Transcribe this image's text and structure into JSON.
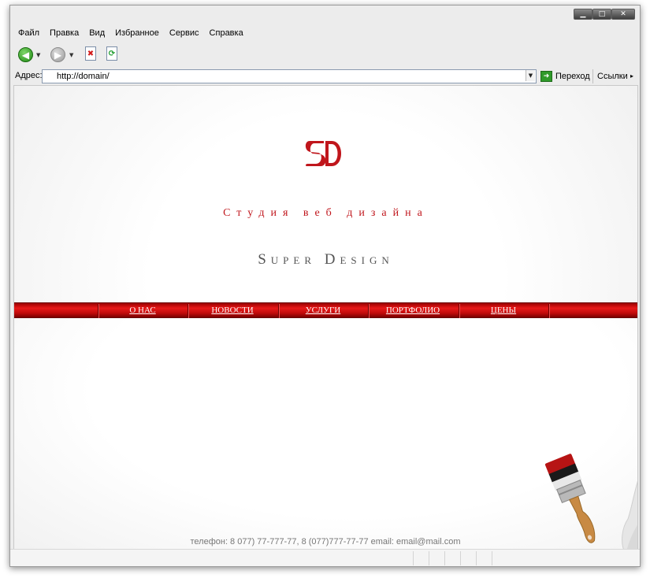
{
  "window": {
    "controls": {
      "minimize": "▁",
      "maximize": "□",
      "close": "✕"
    }
  },
  "menu": {
    "items": [
      "Файл",
      "Правка",
      "Вид",
      "Избранное",
      "Сервис",
      "Справка"
    ]
  },
  "toolbar": {
    "icons": [
      "back-icon",
      "forward-icon",
      "stop-icon",
      "refresh-icon"
    ]
  },
  "address": {
    "label": "Адрес:",
    "url": "http://domain/",
    "go_label": "Переход",
    "links_label": "Ссылки"
  },
  "page": {
    "logo_text": "SD",
    "tagline": "Студия веб дизайна",
    "brand": "Super Design",
    "nav": [
      "О НАС",
      "НОВОСТИ",
      "УСЛУГИ",
      "ПОРТФОЛИО",
      "ЦЕНЫ"
    ],
    "footer": "телефон: 8 077) 77-777-77, 8 (077)777-77-77 email: email@mail.com",
    "colors": {
      "accent": "#c0161c",
      "nav_bar": "#d41414"
    }
  }
}
